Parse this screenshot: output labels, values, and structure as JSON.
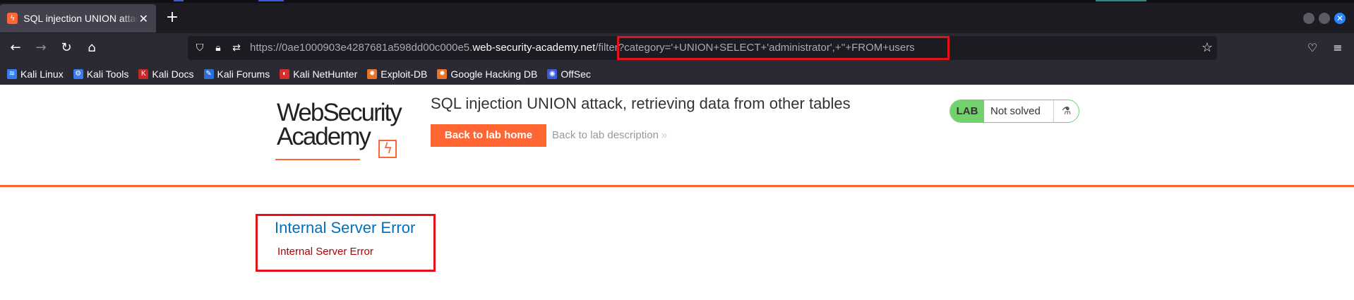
{
  "browser": {
    "tab": {
      "title": "SQL injection UNION attack, retrieving data from other tables",
      "favicon": "ϟ",
      "close": "✕"
    },
    "new_tab": "+",
    "window_close": "✕",
    "url": {
      "scheme": "https://",
      "subdomain": "0ae1000903e4287681a598dd00c000e5.",
      "host": "web-security-academy.net",
      "path": "/filter?category='+UNION+SELECT+'administrator',+''+FROM+users"
    },
    "bookmarks": [
      {
        "label": "Kali Linux",
        "icon": "kali-dragon-icon",
        "color": "#367bf0",
        "glyph": "≋"
      },
      {
        "label": "Kali Tools",
        "icon": "kali-tools-icon",
        "color": "#367bf0",
        "glyph": "⚙"
      },
      {
        "label": "Kali Docs",
        "icon": "kali-docs-icon",
        "color": "#c32b2b",
        "glyph": "K"
      },
      {
        "label": "Kali Forums",
        "icon": "kali-forums-icon",
        "color": "#2a6fd6",
        "glyph": "✎"
      },
      {
        "label": "Kali NetHunter",
        "icon": "nethunter-icon",
        "color": "#d32f2f",
        "glyph": "◐"
      },
      {
        "label": "Exploit-DB",
        "icon": "exploit-db-icon",
        "color": "#e8742a",
        "glyph": "✹"
      },
      {
        "label": "Google Hacking DB",
        "icon": "ghdb-icon",
        "color": "#e8742a",
        "glyph": "✹"
      },
      {
        "label": "OffSec",
        "icon": "offsec-icon",
        "color": "#3b5bdb",
        "glyph": "◉"
      }
    ]
  },
  "lab": {
    "logo_line1": "WebSecurity",
    "logo_line2": "Academy",
    "title": "SQL injection UNION attack, retrieving data from other tables",
    "back_home": "Back to lab home",
    "back_desc": "Back to lab description",
    "back_desc_chevron": "»",
    "badge": "LAB",
    "status": "Not solved",
    "flask": "⚗",
    "accent_color": "#ff6633",
    "status_color": "#70d16d"
  },
  "error": {
    "title": "Internal Server Error",
    "message": "Internal Server Error"
  }
}
